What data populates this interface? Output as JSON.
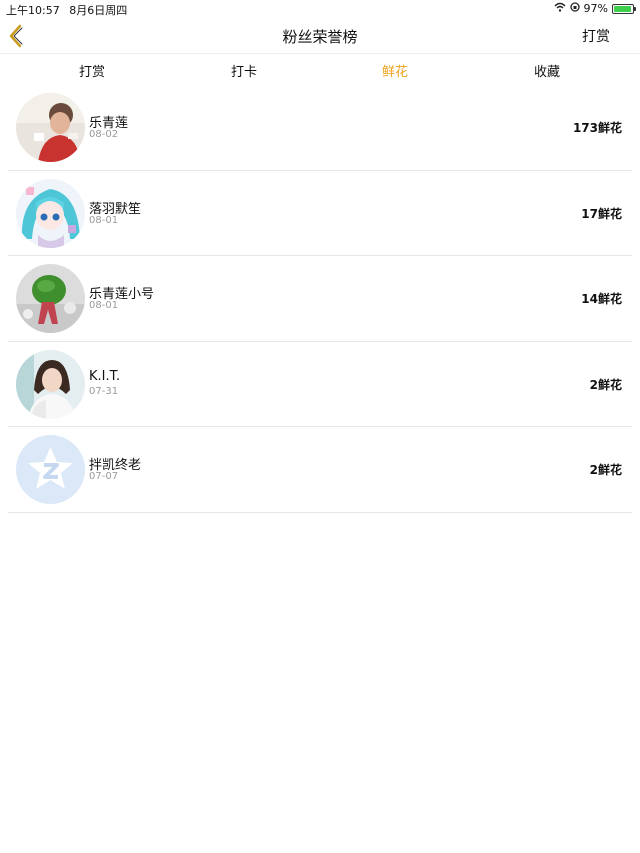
{
  "status_bar": {
    "time": "上午10:57",
    "date": "8月6日周四",
    "battery": "97%",
    "battery_level": 0.97,
    "battery_color": "#3ecf4c"
  },
  "nav": {
    "title": "粉丝荣誉榜",
    "action_label": "打赏",
    "back_icon": "chevron-left-icon",
    "back_color": "#c89a1e"
  },
  "tabs": [
    {
      "label": "打赏",
      "active": false
    },
    {
      "label": "打卡",
      "active": false
    },
    {
      "label": "鲜花",
      "active": true
    },
    {
      "label": "收藏",
      "active": false
    }
  ],
  "accent_color": "#f0a21e",
  "fans": [
    {
      "name": "乐青莲",
      "date": "08-02",
      "amount": "173鲜花",
      "avatar": "child-photo"
    },
    {
      "name": "落羽默笙",
      "date": "08-01",
      "amount": "17鲜花",
      "avatar": "anime-girl"
    },
    {
      "name": "乐青莲小号",
      "date": "08-01",
      "amount": "14鲜花",
      "avatar": "green-bag"
    },
    {
      "name": "K.I.T.",
      "date": "07-31",
      "amount": "2鲜花",
      "avatar": "woman-portrait"
    },
    {
      "name": "拌凯终老",
      "date": "07-07",
      "amount": "2鲜花",
      "avatar": "qzone-logo"
    }
  ]
}
